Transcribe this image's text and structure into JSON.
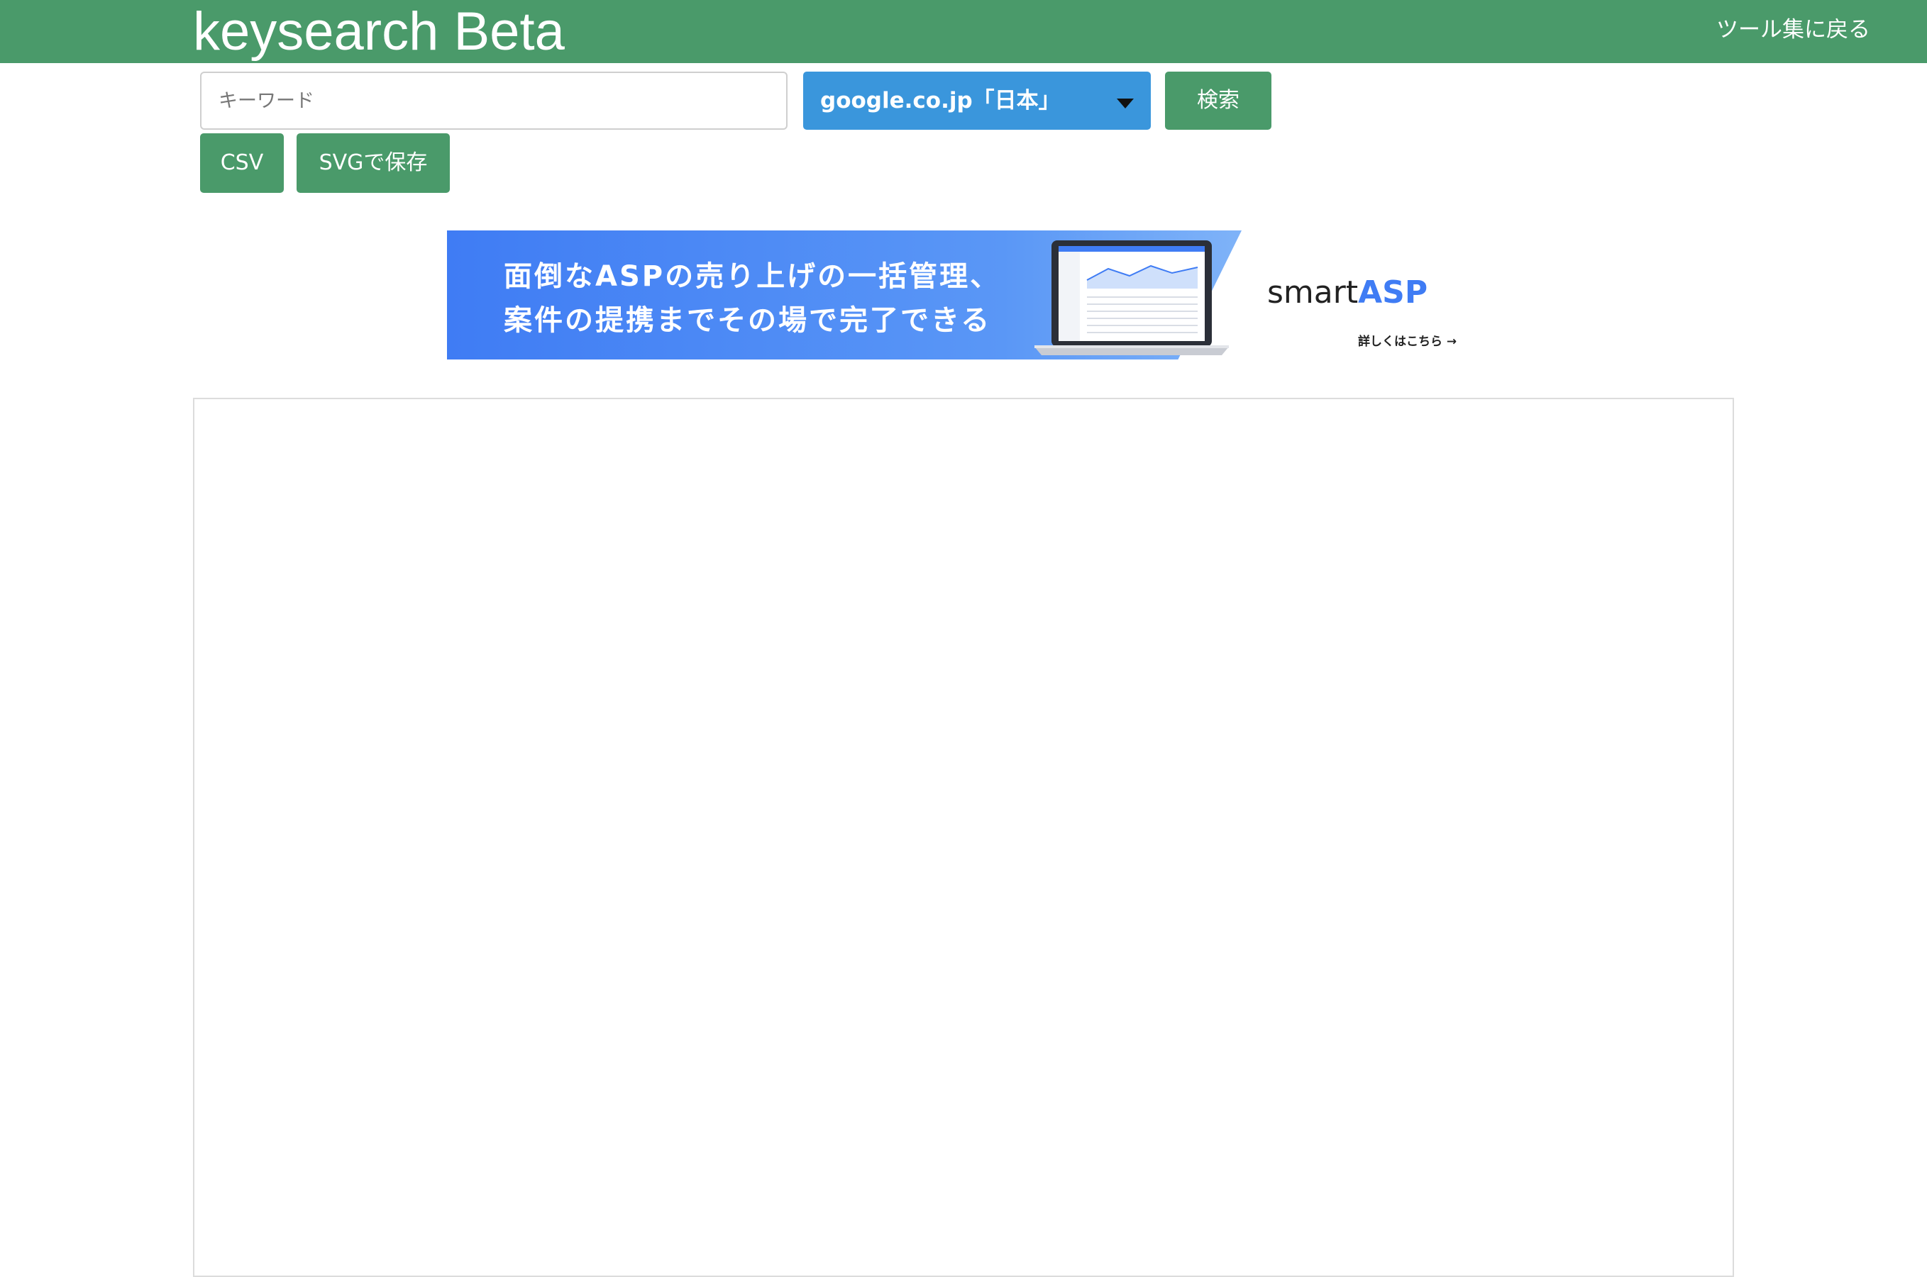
{
  "header": {
    "brand": "keysearch Beta",
    "back_link": "ツール集に戻る"
  },
  "search": {
    "placeholder": "キーワード",
    "value": "",
    "engine_selected": "google.co.jp「日本」",
    "search_label": "検索"
  },
  "actions": {
    "csv_label": "CSV",
    "svg_label": "SVGで保存"
  },
  "banner": {
    "line1": "面倒なASPの売り上げの一括管理、",
    "line2": "案件の提携までその場で完了できる",
    "logo_smart": "smart",
    "logo_asp": "ASP",
    "detail_link": "詳しくはこちら →"
  },
  "colors": {
    "header": "#4a9a6a",
    "select": "#3a96dc",
    "banner_blue": "#3f7cf4"
  }
}
